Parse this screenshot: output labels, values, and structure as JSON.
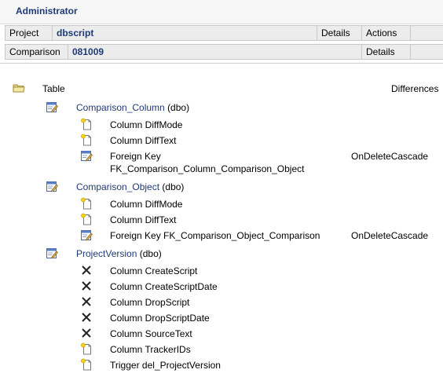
{
  "header": {
    "title": "Administrator"
  },
  "project_row": {
    "label": "Project",
    "value": "dbscript",
    "details": "Details",
    "actions": "Actions"
  },
  "comparison_row": {
    "label": "Comparison",
    "value": "081009",
    "details": "Details"
  },
  "tree": {
    "root_label": "Table",
    "differences_header": "Differences",
    "tables": [
      {
        "name": "Comparison_Column",
        "schema": "(dbo)",
        "items": [
          {
            "icon": "new-item-icon",
            "text": "Column DiffMode",
            "difference": ""
          },
          {
            "icon": "new-item-icon",
            "text": "Column DiffText",
            "difference": ""
          },
          {
            "icon": "edit-icon",
            "text": "Foreign Key",
            "text2": "FK_Comparison_Column_Comparison_Object",
            "difference": "OnDeleteCascade"
          }
        ]
      },
      {
        "name": "Comparison_Object",
        "schema": "(dbo)",
        "items": [
          {
            "icon": "new-item-icon",
            "text": "Column DiffMode",
            "difference": ""
          },
          {
            "icon": "new-item-icon",
            "text": "Column DiffText",
            "difference": ""
          },
          {
            "icon": "edit-icon",
            "text": "Foreign Key FK_Comparison_Object_Comparison",
            "difference": "OnDeleteCascade"
          }
        ]
      },
      {
        "name": "ProjectVersion",
        "schema": "(dbo)",
        "items": [
          {
            "icon": "delete-icon",
            "text": "Column CreateScript",
            "difference": ""
          },
          {
            "icon": "delete-icon",
            "text": "Column CreateScriptDate",
            "difference": ""
          },
          {
            "icon": "delete-icon",
            "text": "Column DropScript",
            "difference": ""
          },
          {
            "icon": "delete-icon",
            "text": "Column DropScriptDate",
            "difference": ""
          },
          {
            "icon": "delete-icon",
            "text": "Column SourceText",
            "difference": ""
          },
          {
            "icon": "new-item-icon",
            "text": "Column TrackerIDs",
            "difference": ""
          },
          {
            "icon": "new-item-icon",
            "text": "Trigger del_ProjectVersion",
            "difference": ""
          }
        ]
      }
    ]
  }
}
